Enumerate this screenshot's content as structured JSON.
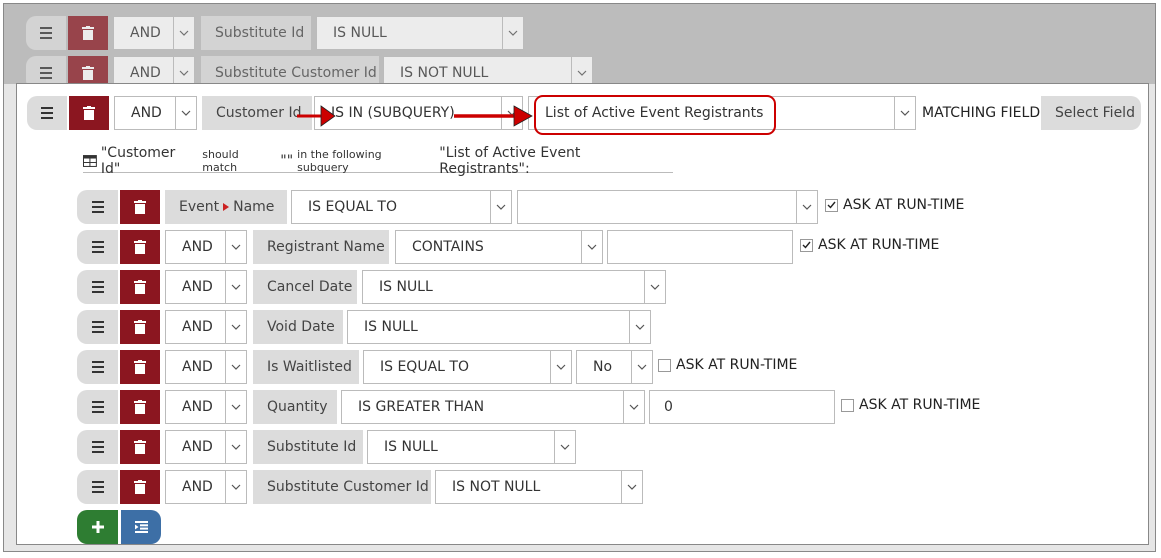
{
  "colors": {
    "delete": "#8b1620",
    "add": "#2e7d32",
    "indent": "#3d6fa6",
    "annotation": "#cc0000"
  },
  "background_rows": [
    {
      "logic": "AND",
      "field": "Substitute Id",
      "operator": "IS NULL"
    },
    {
      "logic": "AND",
      "field": "Substitute Customer Id",
      "operator": "IS NOT NULL"
    }
  ],
  "main_row": {
    "logic": "AND",
    "field": "Customer Id",
    "operator": "IS IN (SUBQUERY)",
    "subquery": "List of Active Event Registrants",
    "matching_label": "MATCHING FIELD:",
    "select_field_label": "Select Field"
  },
  "info": {
    "part1": "\"Customer Id\"",
    "part2": "should match",
    "part3": "\"\"",
    "part4": "in the following subquery",
    "part5": "\"List of Active Event Registrants\":"
  },
  "sub_rows": [
    {
      "logic": "",
      "field_parent": "Event",
      "field": "Name",
      "operator": "IS EQUAL TO",
      "value": "",
      "ask": "ASK AT RUN-TIME",
      "ask_checked": true
    },
    {
      "logic": "AND",
      "field": "Registrant Name",
      "operator": "CONTAINS",
      "value": "",
      "ask": "ASK AT RUN-TIME",
      "ask_checked": true
    },
    {
      "logic": "AND",
      "field": "Cancel Date",
      "operator": "IS NULL"
    },
    {
      "logic": "AND",
      "field": "Void Date",
      "operator": "IS NULL"
    },
    {
      "logic": "AND",
      "field": "Is Waitlisted",
      "operator": "IS EQUAL TO",
      "value": "No",
      "ask": "ASK AT RUN-TIME",
      "ask_checked": false
    },
    {
      "logic": "AND",
      "field": "Quantity",
      "operator": "IS GREATER THAN",
      "value": "0",
      "ask": "ASK AT RUN-TIME",
      "ask_checked": false
    },
    {
      "logic": "AND",
      "field": "Substitute Id",
      "operator": "IS NULL"
    },
    {
      "logic": "AND",
      "field": "Substitute Customer Id",
      "operator": "IS NOT NULL"
    }
  ],
  "icons": [
    "menu-icon",
    "trash-icon",
    "chevron-down-icon",
    "checkbox-icon",
    "table-icon",
    "plus-icon",
    "indent-icon",
    "arrow-right-icon"
  ]
}
